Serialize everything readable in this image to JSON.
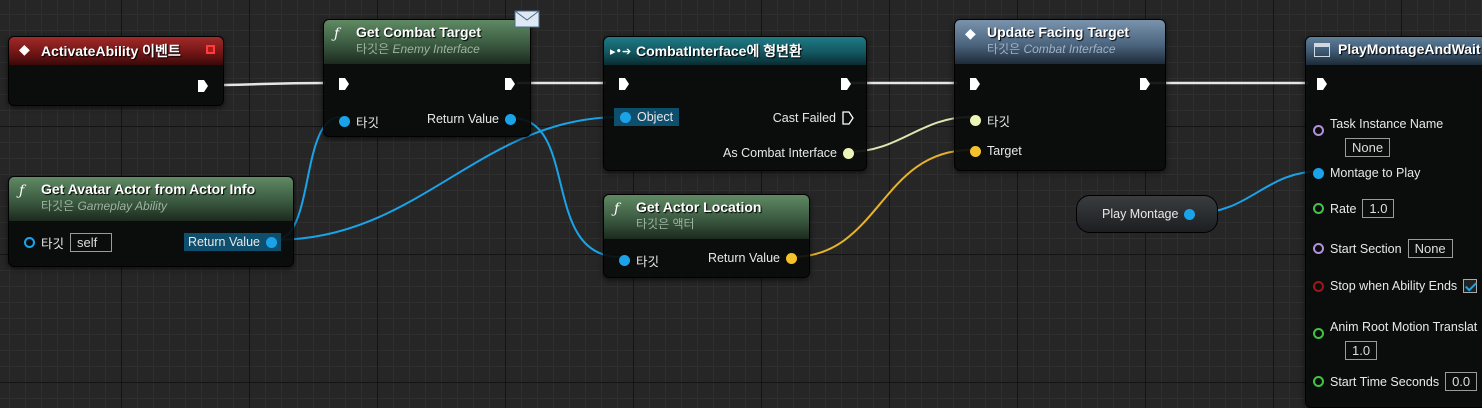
{
  "colors": {
    "exec": "#ffffff",
    "object": "#1aa3e8",
    "vector": "#f5c22b",
    "iface": "#e8f0a0",
    "name": "#b68ee0",
    "float": "#44c244",
    "bool": "#a31515"
  },
  "nodes": {
    "activate": {
      "title": "ActivateAbility 이벤트"
    },
    "get_combat": {
      "title": "Get Combat Target",
      "sub_prefix": "타깃은",
      "sub": "Enemy Interface",
      "pin_target": "타깃",
      "pin_return": "Return Value"
    },
    "cast": {
      "title": "CombatInterface에 형변환",
      "pin_object": "Object",
      "pin_failed": "Cast Failed",
      "pin_as": "As Combat Interface"
    },
    "update_facing": {
      "title": "Update Facing Target",
      "sub_prefix": "타깃은",
      "sub": "Combat Interface",
      "pin_target": "타깃",
      "pin_target2": "Target"
    },
    "get_avatar": {
      "title": "Get Avatar Actor from Actor Info",
      "sub_prefix": "타깃은",
      "sub": "Gameplay Ability",
      "pin_target": "타깃",
      "pin_target_value": "self",
      "pin_return": "Return Value"
    },
    "get_loc": {
      "title": "Get Actor Location",
      "sub": "타깃은 액터",
      "pin_target": "타깃",
      "pin_return": "Return Value"
    },
    "play_montage_var": {
      "label": "Play Montage"
    },
    "task": {
      "title": "PlayMontageAndWait",
      "pins": [
        {
          "label": "Task Instance Name",
          "value": "None"
        },
        {
          "label": "Montage to Play"
        },
        {
          "label": "Rate",
          "value": "1.0"
        },
        {
          "label": "Start Section",
          "value": "None"
        },
        {
          "label": "Stop when Ability Ends"
        },
        {
          "label": "Anim Root Motion Translat",
          "value": "1.0"
        },
        {
          "label": "Start Time Seconds",
          "value": "0.0"
        }
      ]
    }
  }
}
